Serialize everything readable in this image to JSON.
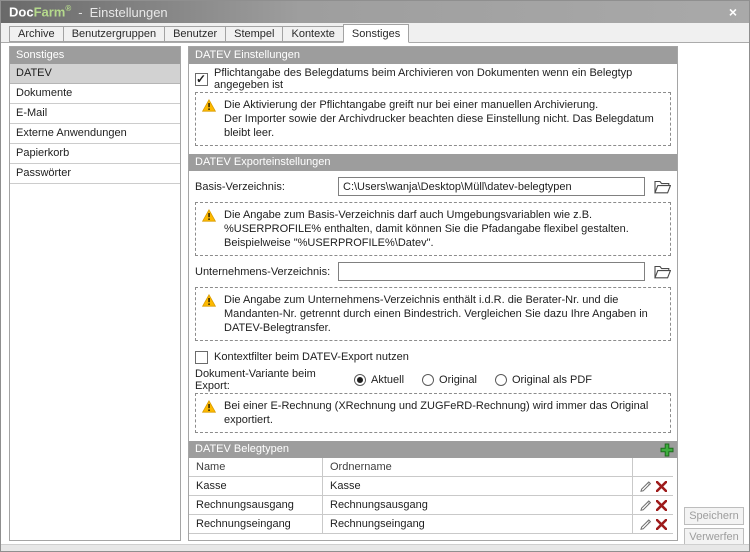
{
  "titlebar": {
    "app_name_primary": "Doc",
    "app_name_secondary": "Farm",
    "registered_mark": "®",
    "separator": "-",
    "page_title": "Einstellungen",
    "close_glyph": "×"
  },
  "tabs": [
    {
      "label": "Archive",
      "active": false
    },
    {
      "label": "Benutzergruppen",
      "active": false
    },
    {
      "label": "Benutzer",
      "active": false
    },
    {
      "label": "Stempel",
      "active": false
    },
    {
      "label": "Kontexte",
      "active": false
    },
    {
      "label": "Sonstiges",
      "active": true
    }
  ],
  "sidebar": {
    "header": "Sonstiges",
    "items": [
      {
        "label": "DATEV",
        "selected": true
      },
      {
        "label": "Dokumente",
        "selected": false
      },
      {
        "label": "E-Mail",
        "selected": false
      },
      {
        "label": "Externe Anwendungen",
        "selected": false
      },
      {
        "label": "Papierkorb",
        "selected": false
      },
      {
        "label": "Passwörter",
        "selected": false
      }
    ]
  },
  "settings_section": {
    "title": "DATEV Einstellungen",
    "mandatory_date_checkbox": {
      "label": "Pflichtangabe des Belegdatums beim Archivieren von Dokumenten wenn ein Belegtyp angegeben ist",
      "checked": true
    },
    "warning_line1": "Die Aktivierung der Pflichtangabe greift nur bei einer manuellen Archivierung.",
    "warning_line2": "Der Importer sowie der Archivdrucker beachten diese Einstellung nicht. Das Belegdatum bleibt leer."
  },
  "export_section": {
    "title": "DATEV Exporteinstellungen",
    "base_dir": {
      "label": "Basis-Verzeichnis:",
      "value": "C:\\Users\\wanja\\Desktop\\Müll\\datev-belegtypen"
    },
    "base_dir_warning_line1": "Die Angabe zum Basis-Verzeichnis darf auch Umgebungsvariablen wie z.B. %USERPROFILE% enthalten, damit können Sie die Pfadangabe flexibel gestalten.",
    "base_dir_warning_line2": "Beispielweise \"%USERPROFILE%\\Datev\".",
    "company_dir": {
      "label": "Unternehmens-Verzeichnis:",
      "value": ""
    },
    "company_dir_warning": "Die Angabe zum Unternehmens-Verzeichnis enthält i.d.R. die Berater-Nr. und die Mandanten-Nr. getrennt durch einen Bindestrich. Vergleichen Sie dazu Ihre Angaben in DATEV-Belegtransfer.",
    "context_filter_checkbox": {
      "label": "Kontextfilter beim DATEV-Export nutzen",
      "checked": false
    },
    "variant": {
      "label": "Dokument-Variante beim Export:",
      "options": [
        {
          "label": "Aktuell",
          "selected": true
        },
        {
          "label": "Original",
          "selected": false
        },
        {
          "label": "Original als PDF",
          "selected": false
        }
      ]
    },
    "variant_warning": "Bei einer E-Rechnung (XRechnung und ZUGFeRD-Rechnung) wird immer das Original exportiert."
  },
  "belegtypen_section": {
    "title": "DATEV Belegtypen",
    "columns": [
      "Name",
      "Ordnername"
    ],
    "rows": [
      {
        "name": "Kasse",
        "folder": "Kasse"
      },
      {
        "name": "Rechnungsausgang",
        "folder": "Rechnungsausgang"
      },
      {
        "name": "Rechnungseingang",
        "folder": "Rechnungseingang"
      }
    ]
  },
  "footer": {
    "save": "Speichern",
    "discard": "Verwerfen"
  },
  "colors": {
    "accent_green": "#b5d98c",
    "header_gray": "#9d9d9d",
    "warning_yellow": "#fdb900",
    "delete_red": "#9e1b1b",
    "add_green": "#3fae3f"
  }
}
